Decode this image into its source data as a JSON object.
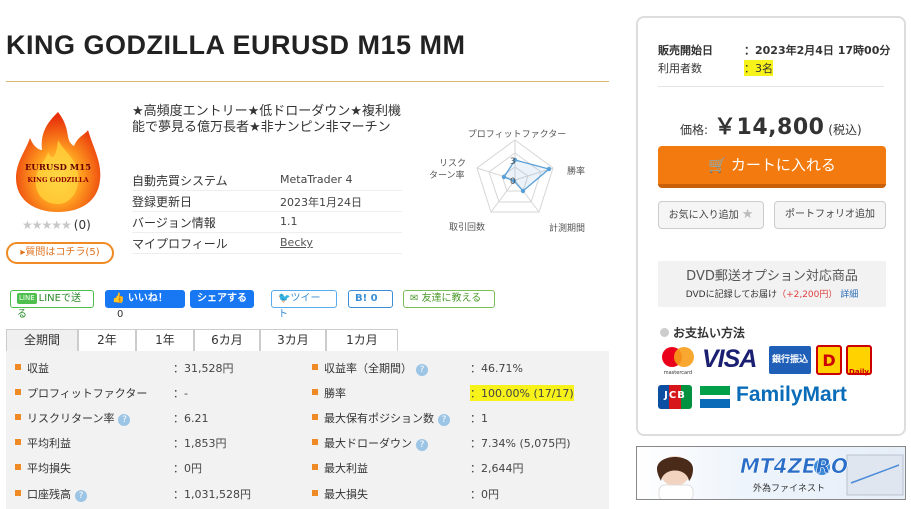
{
  "product": {
    "title": "KING GODZILLA EURUSD M15 MM",
    "logo_line1": "EURUSD M15",
    "logo_line2": "KING GODZILLA",
    "stars": "★★★★★",
    "review_count": "(0)",
    "question_button": "▸質問はコチラ(5)",
    "catchphrase": "★高頻度エントリー★低ドローダウン★複利機能で夢見る億万長者★非ナンピン非マーチン"
  },
  "info": [
    {
      "label": "自動売買システム",
      "value": "MetaTrader 4"
    },
    {
      "label": "登録更新日",
      "value": "2023年1月24日"
    },
    {
      "label": "バージョン情報",
      "value": "1.1"
    },
    {
      "label": "マイプロフィール",
      "value": "Becky"
    }
  ],
  "radar": {
    "labels": {
      "pf": "プロフィットファクター",
      "win": "勝率",
      "period": "計測期間",
      "trades": "取引回数",
      "risk1": "リスク",
      "risk2": "ターン率"
    },
    "tick_3": "3",
    "tick_0": "0"
  },
  "social": {
    "line_badge": "LINE",
    "line_label": "LINEで送る",
    "like_label": "👍 いいね！",
    "like_count": "0",
    "share_label": "シェアする",
    "tweet_label": "ツイート",
    "hatena_label": "B! 0",
    "friend_label": "友達に教える"
  },
  "tabs": [
    "全期間",
    "2年",
    "1年",
    "6カ月",
    "3カ月",
    "1カ月"
  ],
  "stats_left": [
    {
      "label": "収益",
      "value": "：31,528円",
      "help": false
    },
    {
      "label": "プロフィットファクター",
      "value": "：-",
      "help": false
    },
    {
      "label": "リスクリターン率",
      "value": "：6.21",
      "help": true
    },
    {
      "label": "平均利益",
      "value": "：1,853円",
      "help": false
    },
    {
      "label": "平均損失",
      "value": "：0円",
      "help": false
    },
    {
      "label": "口座残高",
      "value": "：1,031,528円",
      "help": true
    }
  ],
  "stats_right": [
    {
      "label": "収益率（全期間）",
      "value": "：46.71%",
      "help": true
    },
    {
      "label": "勝率",
      "value": "：100.00% (17/17)",
      "help": false
    },
    {
      "label": "最大保有ポジション数",
      "value": "：1",
      "help": true
    },
    {
      "label": "最大ドローダウン",
      "value": "：7.34% (5,075円)",
      "help": true
    },
    {
      "label": "最大利益",
      "value": "：2,644円",
      "help": false
    },
    {
      "label": "最大損失",
      "value": "：0円",
      "help": false
    }
  ],
  "help_glyph": "?",
  "sidebar": {
    "sale_start_label": "販売開始日",
    "sale_start_value": "：2023年2月4日 17時00分",
    "users_label": "利用者数",
    "users_value": "：3名",
    "price_label": "価格:",
    "price_value": "￥14,800",
    "price_tax": "(税込)",
    "cart_button": "カートに入れる",
    "favorite_button": "お気に入り追加",
    "portfolio_button": "ポートフォリオ追加",
    "dvd_title": "DVD郵送オプション対応商品",
    "dvd_sub": "DVDに記録してお届け",
    "dvd_price": "（+2,200円）",
    "dvd_detail": "詳細",
    "payment_title": "お支払い方法",
    "pay_visa": "VISA",
    "pay_bank": "銀行振込",
    "pay_jcb": "JCB",
    "pay_family": "FamilyMart",
    "pay_master": "mastercard",
    "pay_d": "D",
    "pay_daily": "Daily"
  },
  "banner": {
    "brand": "MT4ZERO",
    "company": "外為ファイネスト"
  },
  "colors": {
    "accent_orange": "#f27a0f",
    "highlight_yellow": "#f7f21a",
    "facebook_blue": "#1877f2"
  }
}
